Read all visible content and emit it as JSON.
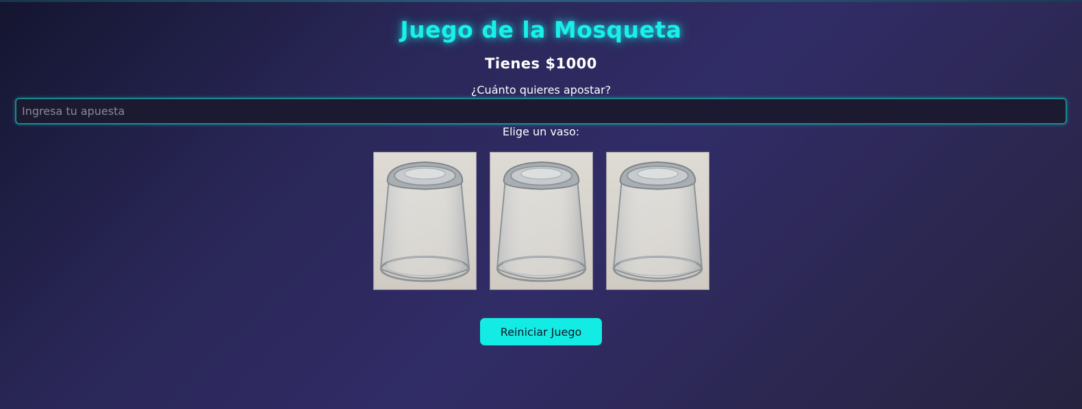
{
  "title": "Juego de la Mosqueta",
  "balance_text": "Tienes $1000",
  "bet": {
    "label": "¿Cuánto quieres apostar?",
    "placeholder": "Ingresa tu apuesta",
    "value": ""
  },
  "cups": {
    "label": "Elige un vaso:",
    "count": 3,
    "items": [
      {
        "alt": "Vaso 1"
      },
      {
        "alt": "Vaso 2"
      },
      {
        "alt": "Vaso 3"
      }
    ]
  },
  "reset_label": "Reiniciar Juego",
  "colors": {
    "accent": "#13ece4",
    "background": "#2a2758",
    "input_background": "#1b1a30"
  }
}
